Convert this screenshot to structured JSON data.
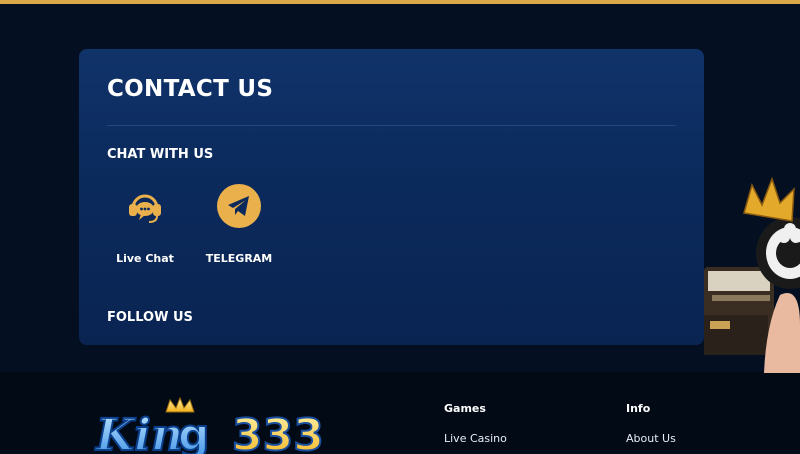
{
  "contact": {
    "title": "CONTACT US",
    "chat_heading": "CHAT WITH US",
    "channels": [
      {
        "label": "Live Chat",
        "icon": "headset-chat-icon"
      },
      {
        "label": "TELEGRAM",
        "icon": "telegram-icon"
      }
    ],
    "follow_heading": "FOLLOW US"
  },
  "footer": {
    "logo_text": "King333",
    "columns": [
      {
        "title": "Games",
        "links": [
          "Live Casino"
        ]
      },
      {
        "title": "Info",
        "links": [
          "About Us"
        ]
      }
    ]
  },
  "colors": {
    "accent_gold": "#d9a94a",
    "card_blue": "#0b2a5c",
    "page_bg": "#041022"
  }
}
